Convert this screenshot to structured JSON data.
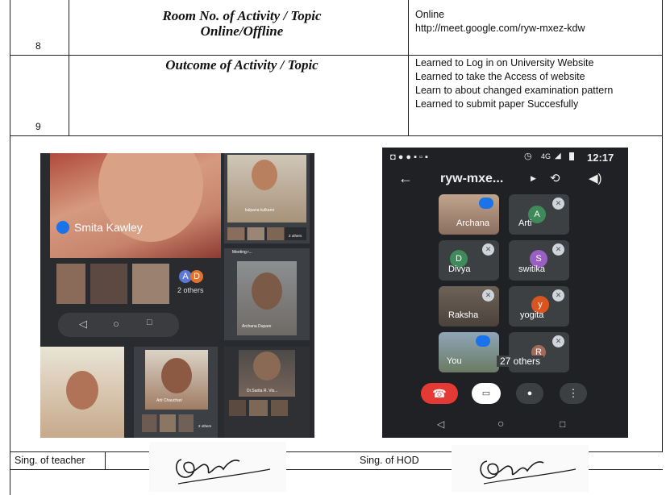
{
  "rows": [
    {
      "num": "8",
      "title_line1": "Room No. of Activity / Topic",
      "title_line2": "Online/Offline",
      "details": [
        "Online",
        "http://meet.google.com/ryw-mxez-kdw"
      ]
    },
    {
      "num": "9",
      "title_line1": "Outcome of Activity / Topic",
      "details": [
        "Learned to Log in on University Website",
        "Learned to  take the Access of website",
        "Learn to about changed examination pattern",
        "Learned to submit paper Succesfully"
      ]
    }
  ],
  "left_collage": {
    "main_name": "Smita Kawley",
    "others_initials": [
      "A",
      "D"
    ],
    "others_label": "2 others",
    "small_name_1": "kalpana kulkarni",
    "small_others": "2 others",
    "meeting_label": "Meeting r...",
    "name_2": "Archana Dupare",
    "name_3": "Arti Chauchari",
    "name_4": "Dr.Sarita R. Vis...",
    "bottom_others": "2 others"
  },
  "phone": {
    "status_time": "12:17",
    "status_net": "4G",
    "meeting_code": "ryw-mxe...",
    "tiles": [
      {
        "name": "Archana",
        "initial": ""
      },
      {
        "name": "Arti",
        "initial": "A"
      },
      {
        "name": "Divya",
        "initial": "D"
      },
      {
        "name": "switika",
        "initial": "S"
      },
      {
        "name": "Raksha",
        "initial": ""
      },
      {
        "name": "yogita",
        "initial": "y"
      },
      {
        "name": "You",
        "initial": ""
      },
      {
        "name": "",
        "initial": "R"
      }
    ],
    "others_label": "27 others"
  },
  "footer": {
    "teacher_label": "Sing. of teacher",
    "hod_label": "Sing. of HOD"
  },
  "colors": {
    "phone_bg": "#202124",
    "end_call": "#e53935",
    "avatar_green": "#3f8a5a",
    "avatar_purple": "#9a5fc2",
    "avatar_orange": "#d9541e"
  }
}
